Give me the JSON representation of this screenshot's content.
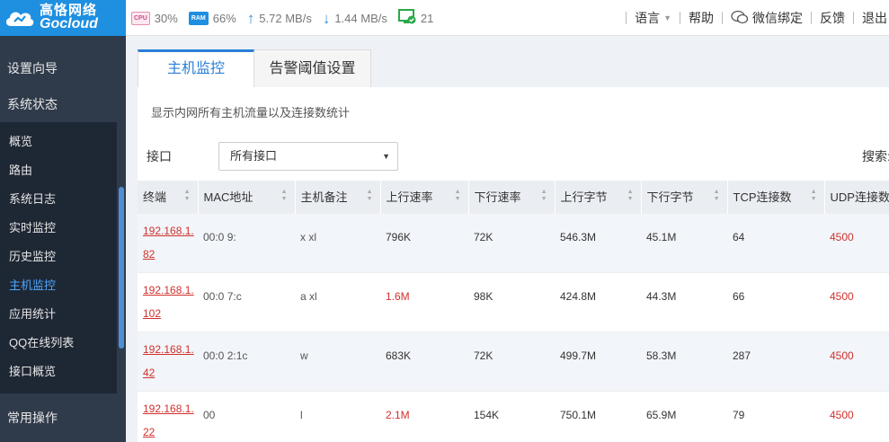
{
  "brand": {
    "name_cn": "高恪网络",
    "name_en": "Gocloud"
  },
  "stats": {
    "cpu_chip": "CPU",
    "cpu": "30%",
    "ram_chip": "RAM",
    "ram": "66%",
    "upload": "5.72 MB/s",
    "download": "1.44 MB/s",
    "online": "21"
  },
  "topnav": {
    "language": "语言",
    "help": "帮助",
    "wechat": "微信绑定",
    "feedback": "反馈",
    "logout": "退出"
  },
  "sidebar": {
    "setup": "设置向导",
    "status": "系统状态",
    "items": [
      "概览",
      "路由",
      "系统日志",
      "实时监控",
      "历史监控",
      "主机监控",
      "应用统计",
      "QQ在线列表",
      "接口概览"
    ],
    "common": "常用操作"
  },
  "tabs": [
    "主机监控",
    "告警阈值设置"
  ],
  "desc": "显示内网所有主机流量以及连接数统计",
  "filter": {
    "label": "接口",
    "value": "所有接口",
    "search_label": "搜索:"
  },
  "table": {
    "headers": [
      "终端",
      "MAC地址",
      "主机备注",
      "上行速率",
      "下行速率",
      "上行字节",
      "下行字节",
      "TCP连接数",
      "UDP连接数"
    ],
    "rows": [
      {
        "ip1": "192.168.1.",
        "ip2": "82",
        "mac": "00:0 9:",
        "note": "x    xl",
        "up": "796K",
        "down": "72K",
        "upb": "546.3M",
        "downb": "45.1M",
        "tcp": "64",
        "udp": "4500"
      },
      {
        "ip1": "192.168.1.",
        "ip2": "102",
        "mac": "00:0 7:c",
        "note": "a    xl",
        "up": "1.6M",
        "down": "98K",
        "upb": "424.8M",
        "downb": "44.3M",
        "tcp": "66",
        "udp": "4500"
      },
      {
        "ip1": "192.168.1.",
        "ip2": "42",
        "mac": "00:0 2:1c",
        "note": "w",
        "up": "683K",
        "down": "72K",
        "upb": "499.7M",
        "downb": "58.3M",
        "tcp": "287",
        "udp": "4500"
      },
      {
        "ip1": "192.168.1.",
        "ip2": "22",
        "mac": "00",
        "note": "   l",
        "up": "2.1M",
        "down": "154K",
        "upb": "750.1M",
        "downb": "65.9M",
        "tcp": "79",
        "udp": "4500"
      }
    ]
  }
}
